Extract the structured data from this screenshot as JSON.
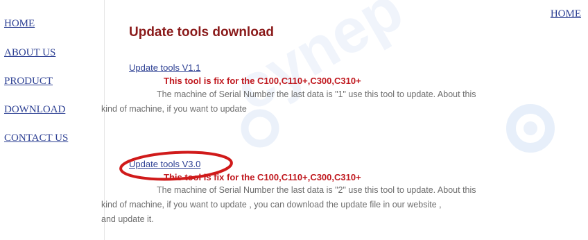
{
  "sidebar": {
    "items": [
      {
        "label": "HOME"
      },
      {
        "label": "ABOUT US"
      },
      {
        "label": "PRODUCT"
      },
      {
        "label": "DOWNLOAD"
      },
      {
        "label": "CONTACT US"
      }
    ]
  },
  "header": {
    "home_link": "HOME"
  },
  "main": {
    "title": "Update tools download",
    "tools": [
      {
        "link": "Update tools V1.1",
        "note": "This tool is fix for the C100,C110+,C300,C310+",
        "desc_lines": [
          "The machine of Serial Number the last data is \"1\" use this tool to update. About this",
          "kind of machine, if you want to update"
        ]
      },
      {
        "link": "Update tools V3.0",
        "note": "This tool is fix for the C100,C110+,C300,C310+",
        "desc_lines": [
          "The machine of Serial Number the last data is \"2\" use this tool to update. About this",
          "kind of machine, if you want to update , you can download the update file in our website ,",
          "and update it."
        ]
      }
    ]
  },
  "watermark": {
    "text": "cynep"
  },
  "colors": {
    "link": "#2c3f93",
    "title": "#8a1a1a",
    "note": "#c0191f",
    "highlight_circle": "#d01a1a"
  }
}
